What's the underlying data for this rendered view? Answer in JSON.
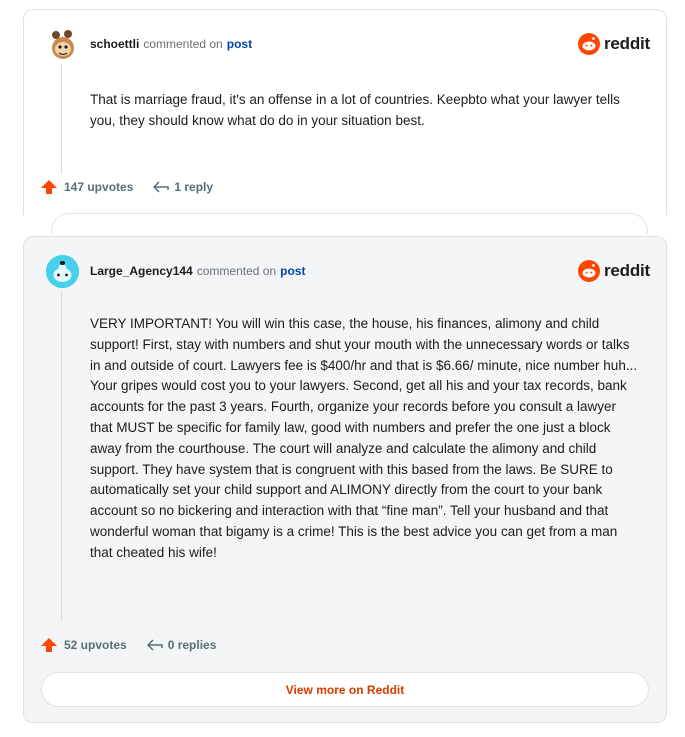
{
  "brand": {
    "name": "reddit",
    "color": "#ff4500"
  },
  "comments": [
    {
      "username": "schoettli",
      "commented_on": "commented on",
      "post_link": "post",
      "body": "That is marriage fraud, it's an offense in a lot of countries. Keepbto what your lawyer tells you, they should know what do do in your situation best.",
      "upvotes": "147 upvotes",
      "replies": "1 reply"
    },
    {
      "username": "Large_Agency144",
      "commented_on": "commented on",
      "post_link": "post",
      "body": "VERY IMPORTANT! You will win this case, the house, his finances, alimony and child support! First, stay with numbers and shut your mouth with the unnecessary words or talks in and outside of court. Lawyers fee is $400/hr and that is $6.66/ minute, nice number huh... Your gripes would cost you to your lawyers. Second, get all his and your tax records, bank accounts for the past 3 years. Fourth, organize your records before you consult a lawyer that MUST be specific for family law, good with numbers and prefer the one just a block away from the courthouse. The court will analyze and calculate the alimony and child support. They have system that is congruent with this based from the laws. Be SURE to automatically set your child support and ALIMONY directly from the court to your bank account so no bickering and interaction with that “fine man”. Tell your husband and that wonderful woman that bigamy is a crime! This is the best advice you can get from a man that cheated his wife!",
      "upvotes": "52 upvotes",
      "replies": "0 replies"
    }
  ],
  "view_more_label": "View more on Reddit"
}
